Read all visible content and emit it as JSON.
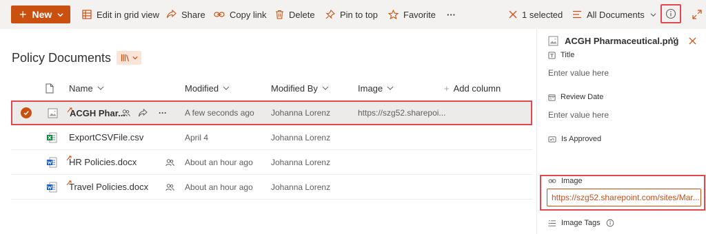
{
  "command_bar": {
    "new_label": "New",
    "edit_grid_label": "Edit in grid view",
    "share_label": "Share",
    "copy_link_label": "Copy link",
    "delete_label": "Delete",
    "pin_label": "Pin to top",
    "favorite_label": "Favorite",
    "more_label": "···",
    "selected_label": "1 selected",
    "view_label": "All Documents"
  },
  "library": {
    "title": "Policy Documents"
  },
  "columns": {
    "name": "Name",
    "modified": "Modified",
    "modified_by": "Modified By",
    "image": "Image",
    "add_column": "Add column"
  },
  "rows": [
    {
      "name": "ACGH Phar...",
      "modified": "A few seconds ago",
      "modified_by": "Johanna Lorenz",
      "image": "https://szg52.sharepoi...",
      "type": "image",
      "selected": true
    },
    {
      "name": "ExportCSVFile.csv",
      "modified": "April 4",
      "modified_by": "Johanna Lorenz",
      "image": "",
      "type": "excel",
      "selected": false
    },
    {
      "name": "HR Policies.docx",
      "modified": "About an hour ago",
      "modified_by": "Johanna Lorenz",
      "image": "",
      "type": "word",
      "selected": false
    },
    {
      "name": "Travel Policies.docx",
      "modified": "About an hour ago",
      "modified_by": "Johanna Lorenz",
      "image": "",
      "type": "word",
      "selected": false
    }
  ],
  "pane": {
    "file_name": "ACGH Pharmaceutical.png",
    "more_label": "···",
    "fields": {
      "title_label": "Title",
      "title_placeholder": "Enter value here",
      "review_label": "Review Date",
      "review_placeholder": "Enter value here",
      "approved_label": "Is Approved",
      "image_label": "Image",
      "image_value": "https://szg52.sharepoint.com/sites/Mar...",
      "tags_label": "Image Tags"
    }
  },
  "colors": {
    "accent": "#ca5010",
    "highlight_box": "#e0474c",
    "command_bar_bg": "#f3f2f1"
  }
}
